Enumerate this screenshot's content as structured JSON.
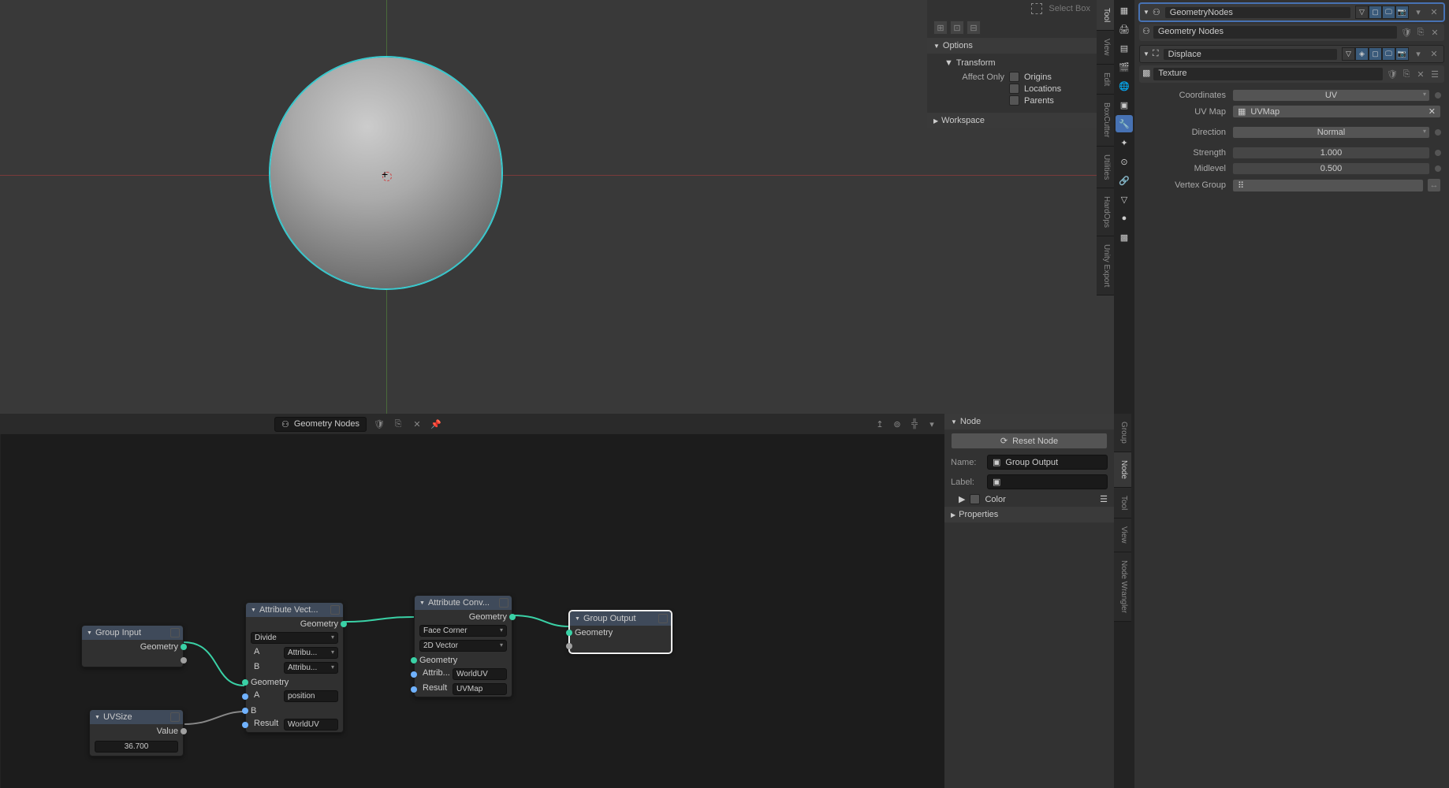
{
  "viewport": {
    "toolbar": {
      "select_box": "Select Box"
    },
    "side_panel": {
      "options_header": "Options",
      "transform_header": "Transform",
      "affect_only_label": "Affect Only",
      "origins": "Origins",
      "locations": "Locations",
      "parents": "Parents",
      "workspace_header": "Workspace"
    },
    "tabs": [
      "Tool",
      "View",
      "Edit",
      "BoxCutter",
      "Utilities",
      "HardOps",
      "Unity Export"
    ]
  },
  "node_editor": {
    "header_title": "Geometry Nodes",
    "side_panel": {
      "node_header": "Node",
      "reset_btn": "Reset Node",
      "name_label": "Name:",
      "name_value": "Group Output",
      "label_label": "Label:",
      "color_label": "Color",
      "properties_header": "Properties"
    },
    "tabs": [
      "Group",
      "Node",
      "Tool",
      "View",
      "Node Wrangler"
    ],
    "nodes": {
      "group_input": {
        "title": "Group Input",
        "out_geom": "Geometry"
      },
      "uvsize": {
        "title": "UVSize",
        "out_value": "Value",
        "value_num": "36.700"
      },
      "attr_vec": {
        "title": "Attribute Vect...",
        "out_geom": "Geometry",
        "op": "Divide",
        "a_lbl": "A",
        "a_field": "Attribu...",
        "b_lbl": "B",
        "b_field": "Attribu...",
        "in_geom": "Geometry",
        "in_a": "A",
        "in_a_val": "position",
        "in_b": "B",
        "result_lbl": "Result",
        "result_val": "WorldUV"
      },
      "attr_conv": {
        "title": "Attribute Conv...",
        "out_geom": "Geometry",
        "domain": "Face Corner",
        "dtype": "2D Vector",
        "in_geom": "Geometry",
        "attrib_lbl": "Attrib...",
        "attrib_val": "WorldUV",
        "result_lbl": "Result",
        "result_val": "UVMap"
      },
      "group_output": {
        "title": "Group Output",
        "in_geom": "Geometry"
      }
    }
  },
  "properties": {
    "modifiers": {
      "geom_nodes": {
        "name": "GeometryNodes",
        "subname": "Geometry Nodes"
      },
      "displace": {
        "name": "Displace",
        "texture_label": "Texture",
        "coords_label": "Coordinates",
        "coords_val": "UV",
        "uvmap_label": "UV Map",
        "uvmap_val": "UVMap",
        "direction_label": "Direction",
        "direction_val": "Normal",
        "strength_label": "Strength",
        "strength_val": "1.000",
        "midlevel_label": "Midlevel",
        "midlevel_val": "0.500",
        "vgroup_label": "Vertex Group"
      }
    }
  }
}
